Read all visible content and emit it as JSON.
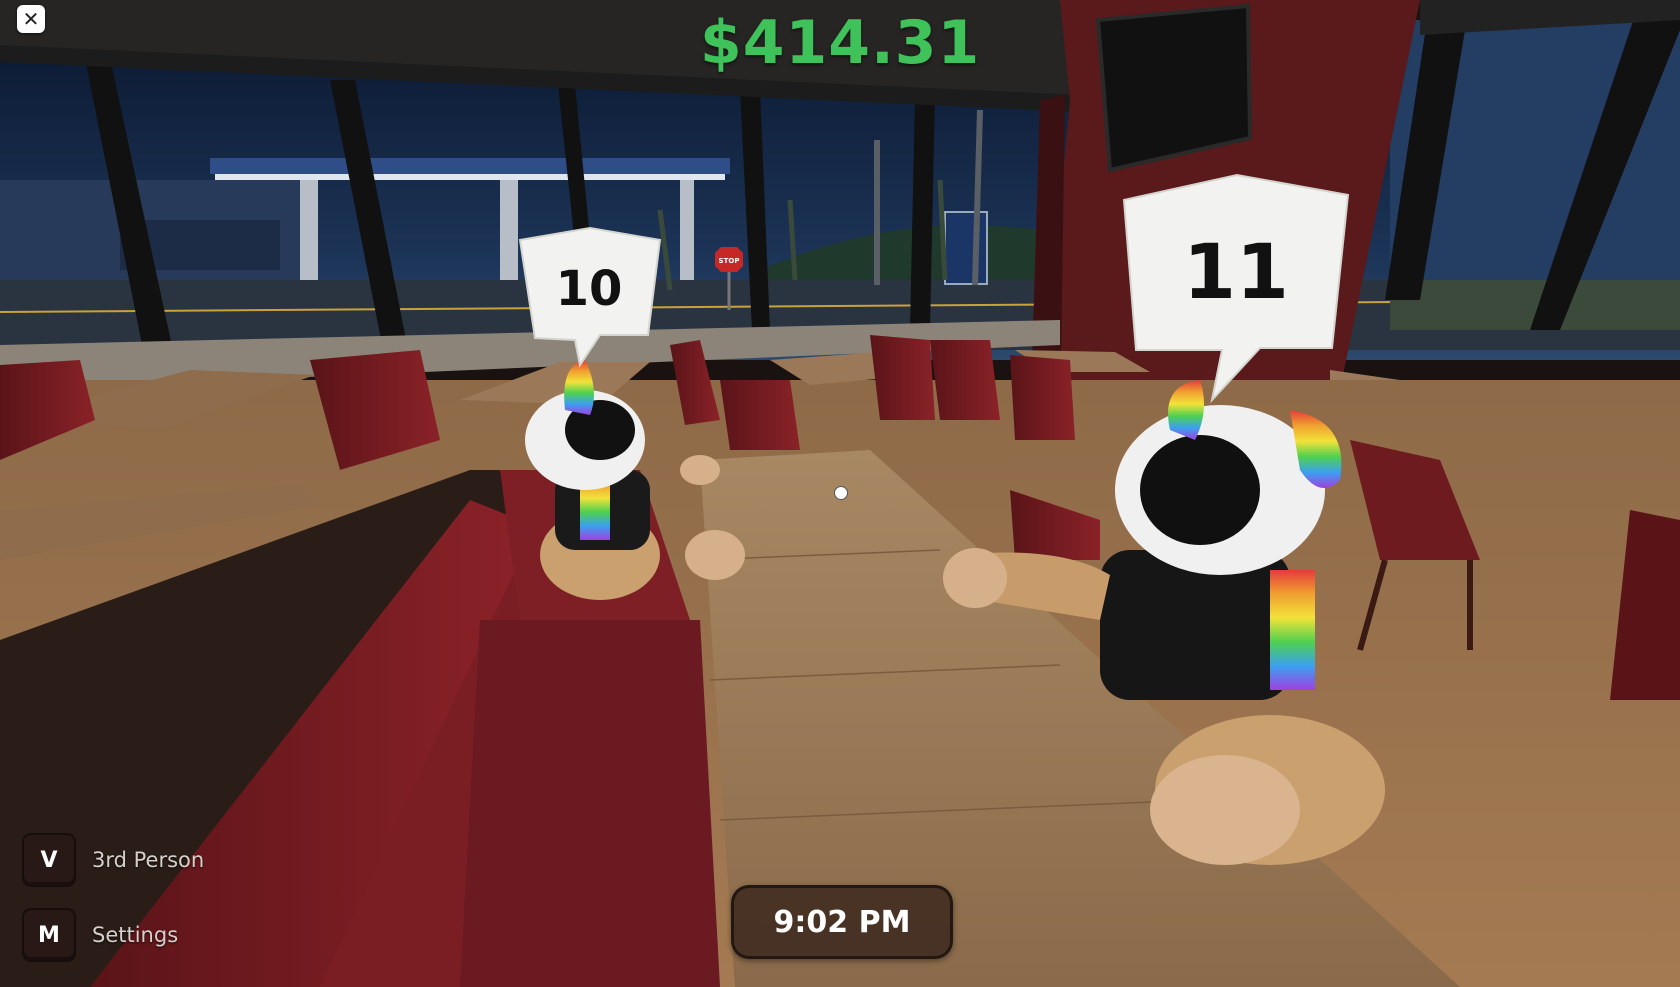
{
  "hud": {
    "money": "$414.31",
    "money_color": "#3fc25a",
    "clock": "9:02 PM",
    "close_icon": "✕"
  },
  "customers": [
    {
      "number": "10"
    },
    {
      "number": "11"
    }
  ],
  "keybinds": [
    {
      "key": "V",
      "label": "3rd Person"
    },
    {
      "key": "M",
      "label": "Settings"
    }
  ],
  "scene": {
    "stop_sign": "STOP"
  }
}
